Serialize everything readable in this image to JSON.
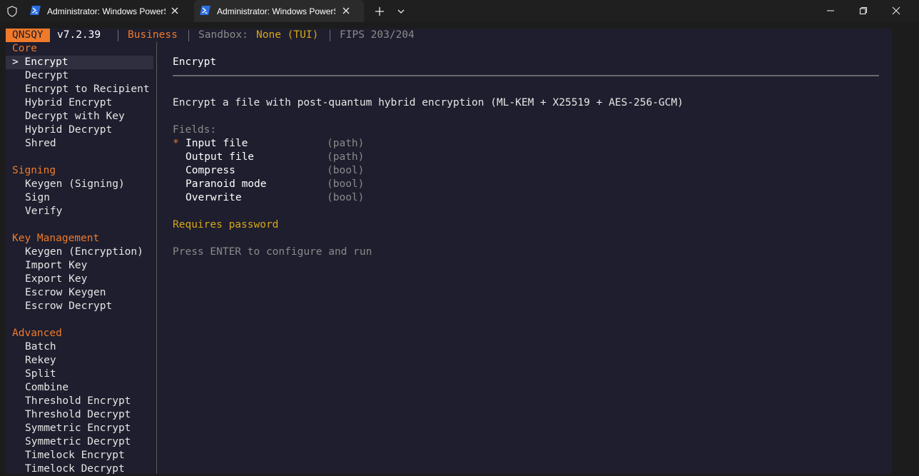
{
  "window": {
    "tabs": [
      {
        "label": "Administrator: Windows PowerShell",
        "active": false
      },
      {
        "label": "Administrator: Windows PowerShell",
        "active": true
      }
    ]
  },
  "status": {
    "brand": "QNSQY",
    "version": "v7.2.39",
    "tier": "Business",
    "sandbox_label": "Sandbox:",
    "sandbox_value": "None (TUI)",
    "fips": "FIPS 203/204"
  },
  "sidebar": {
    "categories": [
      {
        "name": "Core",
        "items": [
          "Encrypt",
          "Decrypt",
          "Encrypt to Recipient",
          "Hybrid Encrypt",
          "Decrypt with Key",
          "Hybrid Decrypt",
          "Shred"
        ]
      },
      {
        "name": "Signing",
        "items": [
          "Keygen (Signing)",
          "Sign",
          "Verify"
        ]
      },
      {
        "name": "Key Management",
        "items": [
          "Keygen (Encryption)",
          "Import Key",
          "Export Key",
          "Escrow Keygen",
          "Escrow Decrypt"
        ]
      },
      {
        "name": "Advanced",
        "items": [
          "Batch",
          "Rekey",
          "Split",
          "Combine",
          "Threshold Encrypt",
          "Threshold Decrypt",
          "Symmetric Encrypt",
          "Symmetric Decrypt",
          "Timelock Encrypt",
          "Timelock Decrypt"
        ]
      }
    ],
    "selected_marker": ">"
  },
  "main": {
    "title": "Encrypt",
    "description": "Encrypt a file with post-quantum hybrid encryption (ML-KEM + X25519 + AES-256-GCM)",
    "fields_label": "Fields:",
    "fields": [
      {
        "name": "Input file",
        "type": "(path)",
        "required": true
      },
      {
        "name": "Output file",
        "type": "(path)",
        "required": false
      },
      {
        "name": "Compress",
        "type": "(bool)",
        "required": false
      },
      {
        "name": "Paranoid mode",
        "type": "(bool)",
        "required": false
      },
      {
        "name": "Overwrite",
        "type": "(bool)",
        "required": false
      }
    ],
    "required_marker": "*",
    "note": "Requires password",
    "hint": "Press ENTER to configure and run"
  },
  "colors": {
    "accent": "#f07a2a",
    "warning": "#d7a716",
    "muted": "#8a8a8a",
    "panel_bg": "#1e1e2e"
  }
}
